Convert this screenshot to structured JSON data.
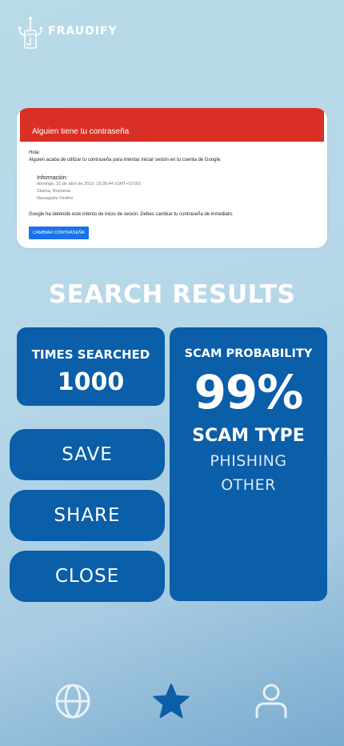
{
  "app": {
    "brand": "FRAUDIFY"
  },
  "preview": {
    "banner_title": "Alguien tiene tu contraseña",
    "greeting": "Hola:",
    "message": "Alguien acaba de utilizar tu contraseña para intentar iniciar sesión en tu cuenta de Google.",
    "info_title": "Información:",
    "info_lines": [
      "domingo, 21 de abril de 2019, 18:38:44 (GMT+02:00)",
      "Slatina, Rumania",
      "Navegador Firefox"
    ],
    "final_message": "Google ha detenido este intento de inicio de sesión. Debes cambiar tu contraseña de inmediato.",
    "button_label": "CAMBIAR CONTRASEÑA"
  },
  "results": {
    "title": "SEARCH RESULTS",
    "times_searched_label": "TIMES SEARCHED",
    "times_searched_value": "1000",
    "scam_probability_label": "SCAM PROBABILITY",
    "scam_probability_value": "99%",
    "scam_type_label": "SCAM TYPE",
    "scam_types": [
      "PHISHING",
      "OTHER"
    ]
  },
  "actions": {
    "save": "SAVE",
    "share": "SHARE",
    "close": "CLOSE"
  },
  "nav": {
    "items": [
      {
        "icon": "globe-icon"
      },
      {
        "icon": "star-icon",
        "active": true
      },
      {
        "icon": "user-icon"
      }
    ]
  },
  "colors": {
    "primary": "#0b5ea8",
    "nav_active": "#0b5ea8",
    "nav_inactive": "#e8f1f6",
    "banner_red": "#d93025"
  }
}
